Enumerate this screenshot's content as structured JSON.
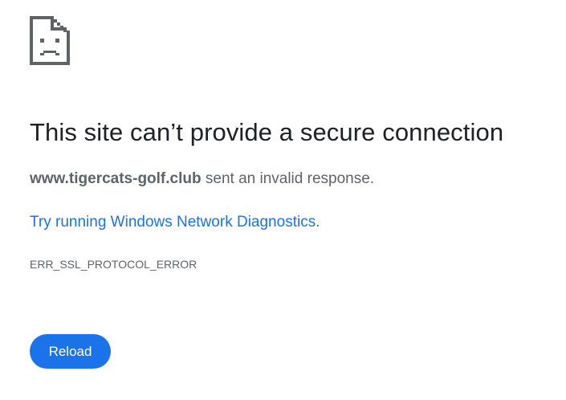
{
  "error_page": {
    "icon": "sad-page-icon",
    "title": "This site can’t provide a secure connection",
    "message_host": "www.tigercats-golf.club",
    "message_rest": " sent an invalid response.",
    "diagnostics_link": "Try running Windows Network Diagnostics.",
    "error_code": "ERR_SSL_PROTOCOL_ERROR",
    "reload_label": "Reload"
  },
  "colors": {
    "title": "#202124",
    "body_text": "#5f6368",
    "link": "#1a73e8",
    "button_bg": "#1a73e8",
    "button_text": "#ffffff"
  }
}
